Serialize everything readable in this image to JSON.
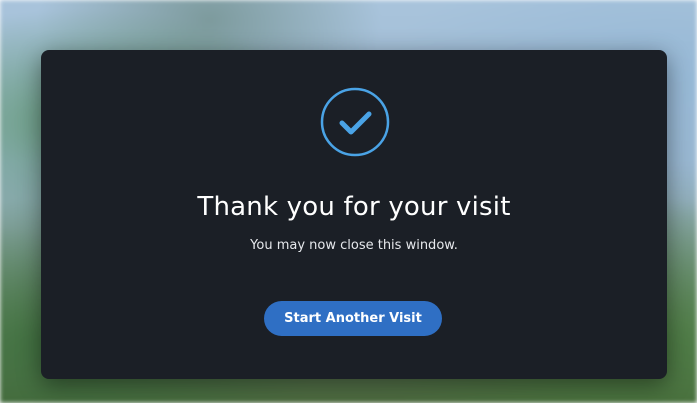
{
  "dialog": {
    "title": "Thank you for your visit",
    "subtitle": "You may now close this window.",
    "button_label": "Start Another Visit",
    "icon": "check-circle-icon"
  },
  "colors": {
    "modal_background": "#1b1f26",
    "accent": "#2f6fc4",
    "icon_color": "#4aa3e6"
  }
}
